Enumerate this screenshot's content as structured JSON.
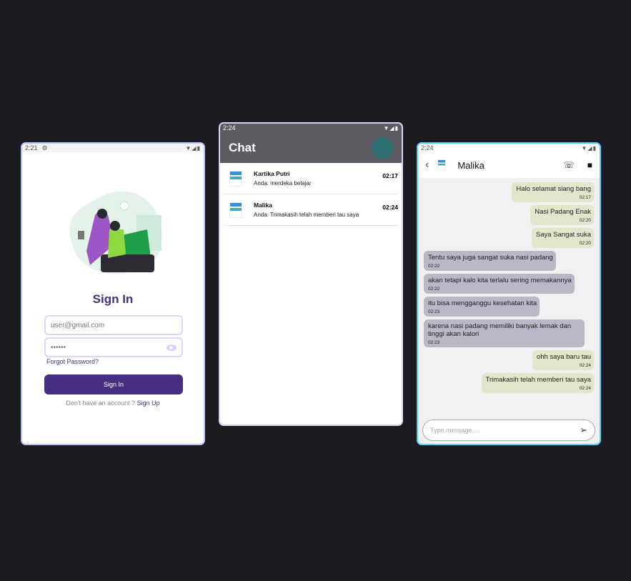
{
  "signin": {
    "status_time": "2:21",
    "title": "Sign In",
    "email_placeholder": "user@gmail.com",
    "password_value": "••••••",
    "forgot": "Forgot Password?",
    "button": "Sign In",
    "no_account": "Don't have an account ?",
    "signup": "Sign Up"
  },
  "chatlist": {
    "status_time": "2:24",
    "title": "Chat",
    "logo_text": "LP LP",
    "items": [
      {
        "name": "Kartika Putri",
        "message": "Anda: merdeka belajar",
        "time": "02:17"
      },
      {
        "name": "Malika",
        "message": "Anda: Trimakasih telah memberi tau saya",
        "time": "02:24"
      }
    ]
  },
  "thread": {
    "status_time": "2:24",
    "contact": "Malika",
    "input_placeholder": "Type message....",
    "messages": [
      {
        "dir": "sent",
        "text": "Halo selamat siang bang",
        "time": "02:17"
      },
      {
        "dir": "sent",
        "text": "Nasi Padang Enak",
        "time": "02:20"
      },
      {
        "dir": "sent",
        "text": "Saya Sangat suka",
        "time": "02:20"
      },
      {
        "dir": "recv",
        "text": "Tentu saya juga sangat suka nasi padang",
        "time": "02:22"
      },
      {
        "dir": "recv",
        "text": "akan tetapi kalo kita terlalu sering memakannya",
        "time": "02:22"
      },
      {
        "dir": "recv",
        "text": "itu bisa mengganggu kesehatan kita",
        "time": "02:23"
      },
      {
        "dir": "recv",
        "text": "karena nasi padang memiliki banyak lemak dan tinggi akan kalori",
        "time": "02:23"
      },
      {
        "dir": "sent",
        "text": "ohh saya baru tau",
        "time": "02:24"
      },
      {
        "dir": "sent",
        "text": "Trimakasih telah memberi tau saya",
        "time": "02:24"
      }
    ]
  },
  "colors": {
    "primary": "#472e82",
    "sent_bubble": "#e4e6cb",
    "recv_bubble": "#b8b8c6",
    "chat_header": "#5b5b61"
  }
}
